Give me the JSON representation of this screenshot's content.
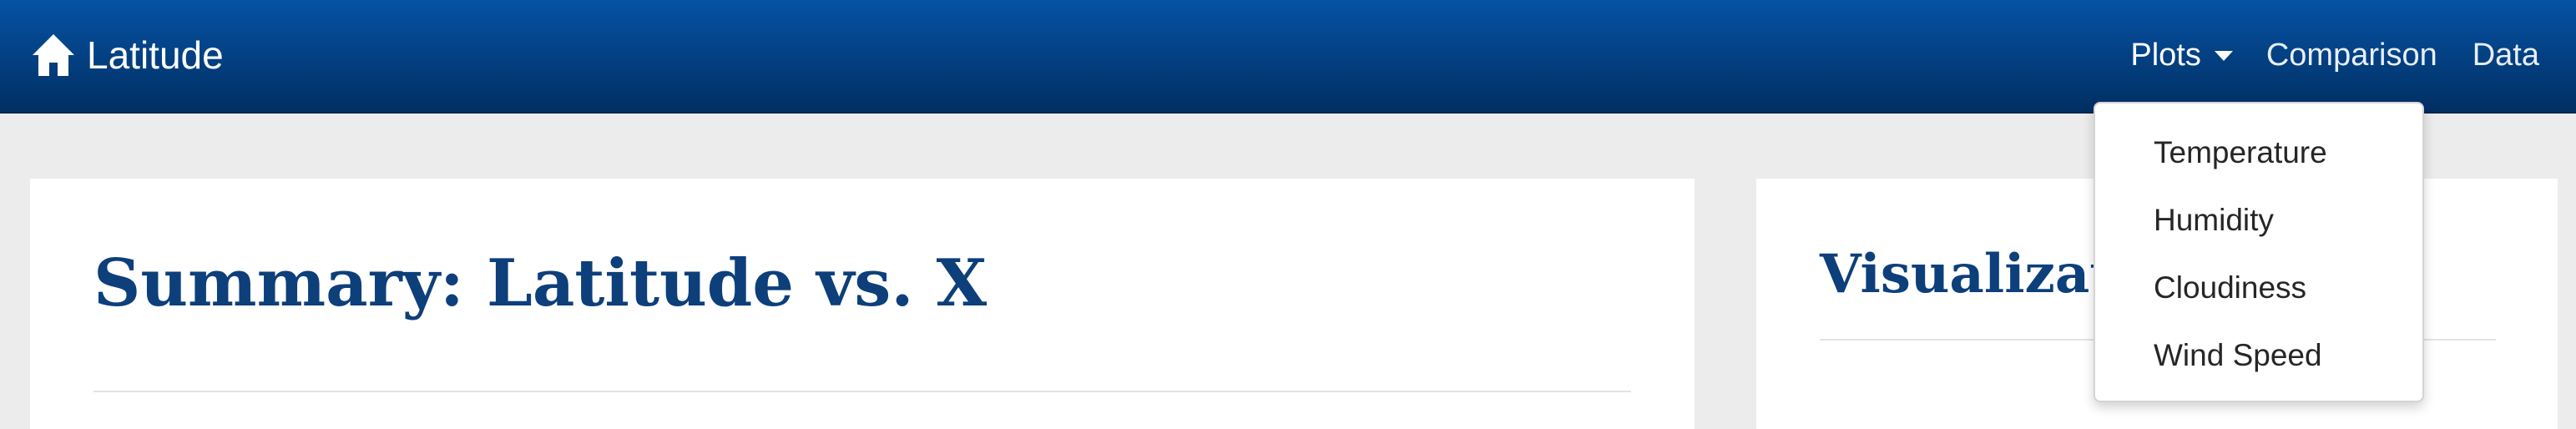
{
  "navbar": {
    "brand_label": "Latitude",
    "brand_icon": "home-icon",
    "items": [
      {
        "label": "Plots",
        "has_dropdown": true
      },
      {
        "label": "Comparison"
      },
      {
        "label": "Data"
      }
    ],
    "colors": {
      "background": "#033f80",
      "text": "#ffffff"
    }
  },
  "dropdown": {
    "items": [
      {
        "label": "Temperature"
      },
      {
        "label": "Humidity"
      },
      {
        "label": "Cloudiness"
      },
      {
        "label": "Wind Speed"
      }
    ]
  },
  "main": {
    "summary_title": "Summary: Latitude vs. X",
    "visualizations_title": "Visualizations",
    "title_color": "#0d3f7a",
    "page_background": "#ececec"
  }
}
